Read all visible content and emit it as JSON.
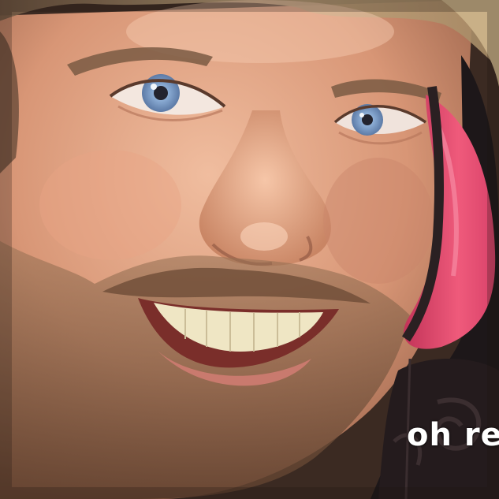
{
  "image": {
    "subject": "close-up-smiling-face",
    "palette": {
      "skin": "#e0a584",
      "skin_shadow": "#a8684b",
      "hair": "#b59a73",
      "beard": "#8a6648",
      "eye_iris": "#7e9cc6",
      "headphone_pink": "#e84a6e",
      "headphone_dark": "#1a1416",
      "teeth": "#efe8c9"
    }
  },
  "caption": {
    "text": "oh re",
    "color": "#ffffff"
  }
}
